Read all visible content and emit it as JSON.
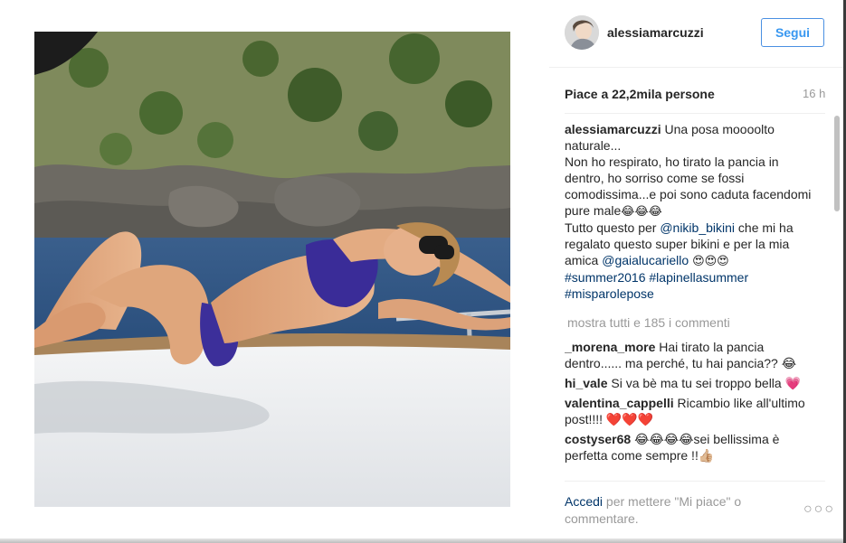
{
  "post": {
    "author": "alessiamarcuzzi",
    "follow_label": "Segui",
    "likes_text": "Piace a 22,2mila persone",
    "time_ago": "16 h",
    "caption": {
      "username": "alessiamarcuzzi",
      "text_1": "Una posa moooolto naturale...",
      "text_2": "Non ho respirato, ho tirato la pancia in dentro, ho sorriso come se fossi comodissima...e poi sono caduta facendomi pure male",
      "emoji_1": "😂😂😂",
      "text_3": "Tutto questo per",
      "mention_1": "@nikib_bikini",
      "text_4": "che mi ha regalato questo super bikini e per la mia amica",
      "mention_2": "@gaialucariello",
      "emoji_2": "😍😍😍",
      "hashtag_1": "#summer2016",
      "hashtag_2": "#lapinellasummer",
      "hashtag_3": "#misparolepose"
    },
    "show_all_comments": "mostra tutti e 185 i commenti",
    "comments": [
      {
        "username": "_morena_more",
        "text": "Hai tirato la pancia dentro...... ma perché, tu hai pancia?? 😂"
      },
      {
        "username": "hi_vale",
        "text": "Si va bè ma tu sei troppo bella 💗"
      },
      {
        "username": "valentina_cappelli",
        "text": "Ricambio like all'ultimo post!!!! ❤️❤️❤️"
      },
      {
        "username": "costyser68",
        "text": "😂😂😂😂sei bellissima è perfetta come sempre !!👍🏼"
      }
    ],
    "login_link": "Accedi",
    "login_text": "per mettere \"Mi piace\" o commentare.",
    "more_icon": "more-horizontal-icon"
  }
}
